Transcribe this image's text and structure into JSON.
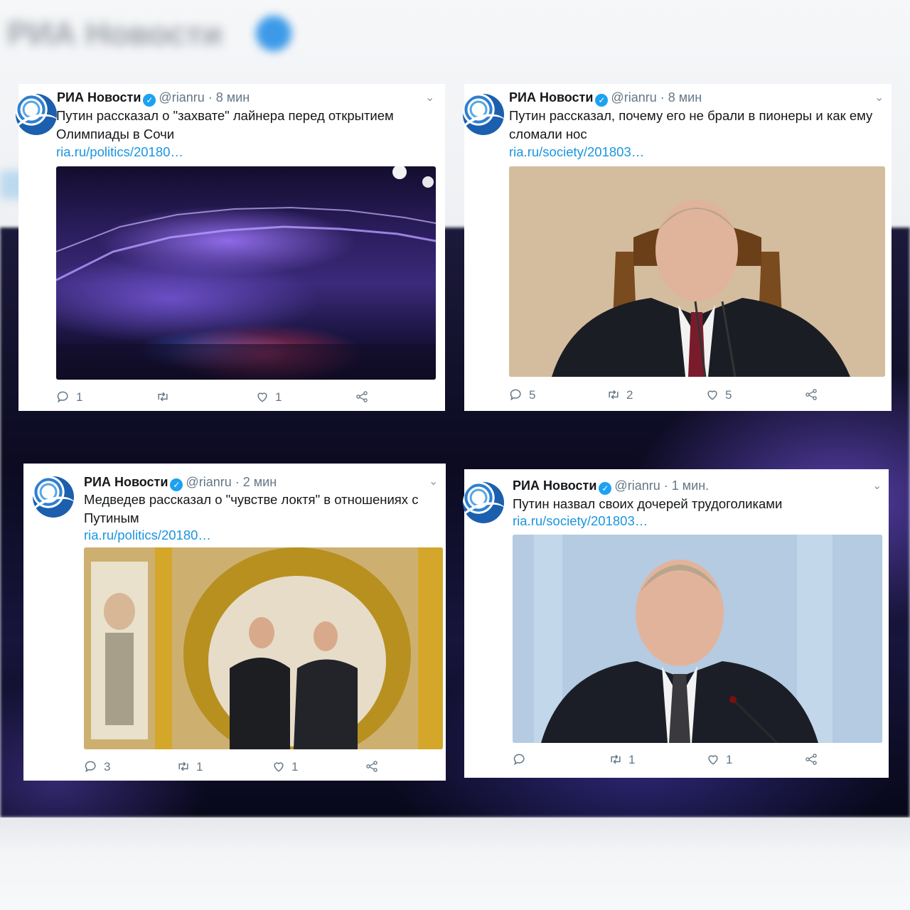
{
  "background": {
    "account_name": "РИА Новости"
  },
  "tweets": [
    {
      "name": "РИА Новости",
      "handle": "@rianru",
      "dot": "·",
      "time": "8 мин",
      "text": "Путин рассказал о \"захвате\" лайнера перед открытием Олимпиады в Сочи",
      "link": "ria.ru/politics/20180…",
      "replies": "1",
      "retweets": "",
      "likes": "1"
    },
    {
      "name": "РИА Новости",
      "handle": "@rianru",
      "dot": "·",
      "time": "8 мин",
      "text": "Путин рассказал, почему его не брали в пионеры и как ему сломали нос",
      "link": "ria.ru/society/201803…",
      "replies": "5",
      "retweets": "2",
      "likes": "5"
    },
    {
      "name": "РИА Новости",
      "handle": "@rianru",
      "dot": "·",
      "time": "2 мин",
      "text": "Медведев рассказал о \"чувстве локтя\" в отношениях с Путиным",
      "link": "ria.ru/politics/20180…",
      "replies": "3",
      "retweets": "1",
      "likes": "1"
    },
    {
      "name": "РИА Новости",
      "handle": "@rianru",
      "dot": "·",
      "time": "1 мин.",
      "text": "Путин назвал своих дочерей трудоголиками",
      "link": "ria.ru/society/201803…",
      "replies": "",
      "retweets": "1",
      "likes": "1"
    }
  ],
  "colors": {
    "link": "#1b95e0",
    "verified": "#1da1f2",
    "secondary_text": "#657786"
  },
  "icons": [
    "reply-icon",
    "retweet-icon",
    "like-icon",
    "share-icon",
    "verified-icon",
    "chevron-down-icon"
  ]
}
